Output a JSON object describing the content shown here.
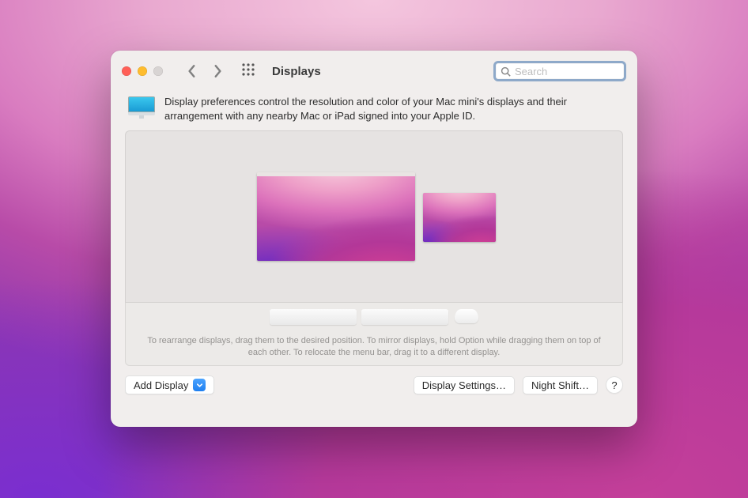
{
  "window": {
    "title": "Displays",
    "search_placeholder": "Search"
  },
  "intro": {
    "text": "Display preferences control the resolution and color of your Mac mini's displays and their arrangement with any nearby Mac or iPad signed into your Apple ID."
  },
  "arrangement": {
    "hint": "To rearrange displays, drag them to the desired position. To mirror displays, hold Option while dragging them on top of each other. To relocate the menu bar, drag it to a different display."
  },
  "footer": {
    "add_display": "Add Display",
    "display_settings": "Display Settings…",
    "night_shift": "Night Shift…",
    "help": "?"
  }
}
